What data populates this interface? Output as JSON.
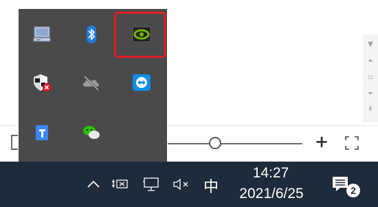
{
  "tray_popup": {
    "icons": [
      {
        "name": "display-adapter-icon",
        "color": "#8fa6cf"
      },
      {
        "name": "bluetooth-icon",
        "color": "#1e7be0"
      },
      {
        "name": "nvidia-icon",
        "color": "#76b900",
        "highlighted": true
      },
      {
        "name": "windows-security-icon",
        "color": "#e81123"
      },
      {
        "name": "onedrive-offline-icon",
        "color": "#9a9a9a"
      },
      {
        "name": "teamviewer-icon",
        "color": "#0e8ee9"
      },
      {
        "name": "pin-app-icon",
        "color": "#3a86ff"
      },
      {
        "name": "wechat-icon",
        "color": "#2dc100"
      }
    ]
  },
  "taskbar": {
    "ime_label": "中",
    "clock_time": "14:27",
    "clock_date": "2021/6/25",
    "notification_count": "2"
  },
  "colors": {
    "taskbar_bg": "#1d2b3a",
    "popup_bg": "#4a4a4a",
    "highlight": "#e02020"
  }
}
